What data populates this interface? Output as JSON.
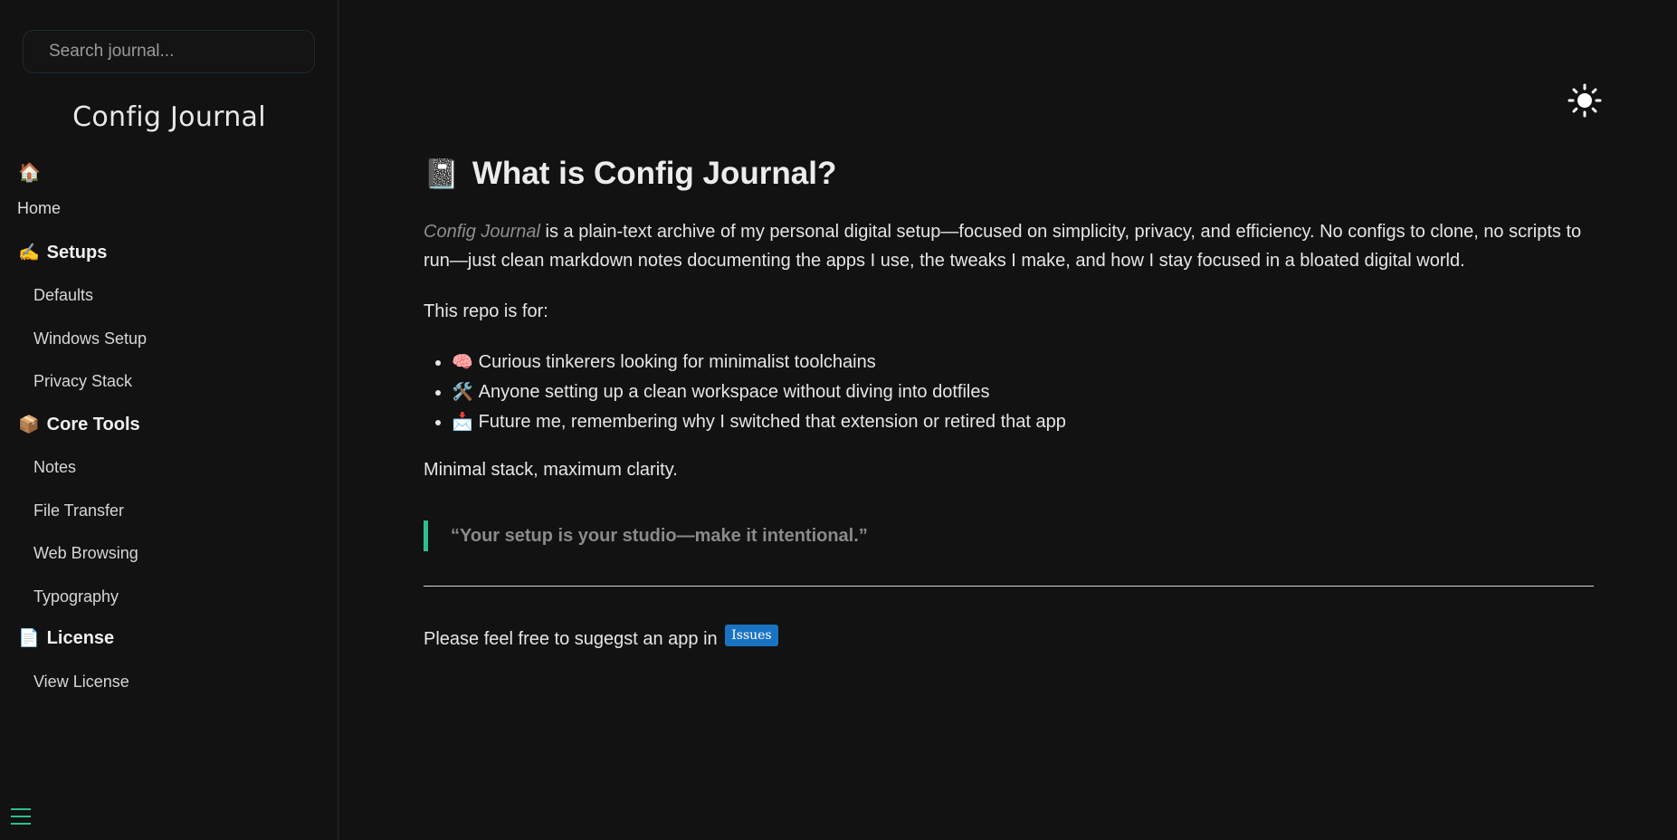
{
  "sidebar": {
    "search": {
      "placeholder": "Search journal...",
      "value": ""
    },
    "title": "Config Journal",
    "home": {
      "emoji": "🏠",
      "label": "Home"
    },
    "sections": [
      {
        "emoji": "✍️",
        "label": "Setups",
        "items": [
          "Defaults",
          "Windows Setup",
          "Privacy Stack"
        ]
      },
      {
        "emoji": "📦",
        "label": "Core Tools",
        "items": [
          "Notes",
          "File Transfer",
          "Web Browsing",
          "Typography"
        ]
      },
      {
        "emoji": "📄",
        "label": "License",
        "items": [
          "View License"
        ]
      }
    ],
    "menu_icon": "hamburger-menu-icon"
  },
  "header": {
    "theme_toggle_icon": "sun-icon"
  },
  "main": {
    "heading": {
      "emoji": "📓",
      "text": "What is Config Journal?"
    },
    "intro": {
      "brand": "Config Journal",
      "text": " is a plain-text archive of my personal digital setup—focused on simplicity, privacy, and efficiency. No configs to clone, no scripts to run—just clean markdown notes documenting the apps I use, the tweaks I make, and how I stay focused in a bloated digital world."
    },
    "repo_for": "This repo is for:",
    "audience": [
      {
        "emoji": "🧠",
        "text": "Curious tinkerers looking for minimalist toolchains"
      },
      {
        "emoji": "🛠️",
        "text": "Anyone setting up a clean workspace without diving into dotfiles"
      },
      {
        "emoji": "📩",
        "text": "Future me, remembering why I switched that extension or retired that app"
      }
    ],
    "tagline": "Minimal stack, maximum clarity.",
    "quote": "“Your setup is your studio—make it intentional.”",
    "feedback": {
      "text": "Please feel free to sugegst an app in",
      "badge": "Issues"
    }
  },
  "colors": {
    "background": "#121212",
    "accent_green": "#2fbf8a",
    "badge_blue": "#1a73c2"
  }
}
